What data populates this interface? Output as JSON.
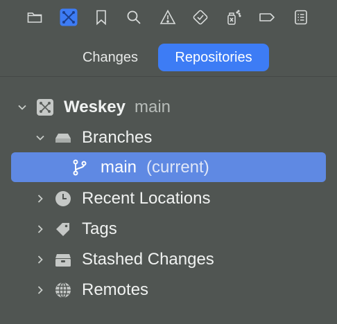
{
  "toolbar": {
    "icons": [
      {
        "name": "folder-icon"
      },
      {
        "name": "source-control-icon",
        "active": true
      },
      {
        "name": "bookmark-icon"
      },
      {
        "name": "search-icon"
      },
      {
        "name": "warning-icon"
      },
      {
        "name": "diamond-check-icon"
      },
      {
        "name": "spray-clean-icon"
      },
      {
        "name": "label-tag-icon"
      },
      {
        "name": "report-list-icon"
      }
    ]
  },
  "segments": {
    "changes": "Changes",
    "repositories": "Repositories",
    "selected": "Repositories"
  },
  "tree": {
    "repo": {
      "name": "Weskey",
      "branch": "main"
    },
    "branches_label": "Branches",
    "current_branch": {
      "name": "main",
      "suffix": "(current)"
    },
    "recent_locations": "Recent Locations",
    "tags": "Tags",
    "stashed_changes": "Stashed Changes",
    "remotes": "Remotes"
  },
  "colors": {
    "background": "#505552",
    "accent": "#3d7cf5",
    "selection": "#5f89e3"
  }
}
